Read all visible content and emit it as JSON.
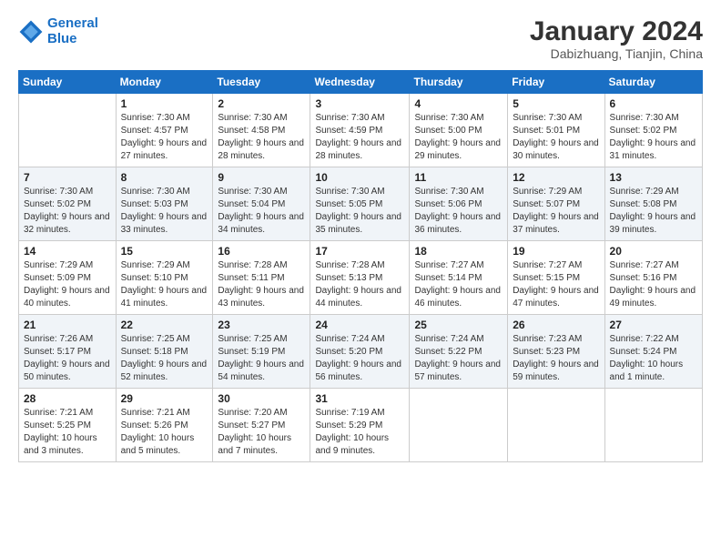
{
  "header": {
    "logo_line1": "General",
    "logo_line2": "Blue",
    "month_title": "January 2024",
    "location": "Dabizhuang, Tianjin, China"
  },
  "days_of_week": [
    "Sunday",
    "Monday",
    "Tuesday",
    "Wednesday",
    "Thursday",
    "Friday",
    "Saturday"
  ],
  "weeks": [
    [
      {
        "num": "",
        "sunrise": "",
        "sunset": "",
        "daylight": ""
      },
      {
        "num": "1",
        "sunrise": "Sunrise: 7:30 AM",
        "sunset": "Sunset: 4:57 PM",
        "daylight": "Daylight: 9 hours and 27 minutes."
      },
      {
        "num": "2",
        "sunrise": "Sunrise: 7:30 AM",
        "sunset": "Sunset: 4:58 PM",
        "daylight": "Daylight: 9 hours and 28 minutes."
      },
      {
        "num": "3",
        "sunrise": "Sunrise: 7:30 AM",
        "sunset": "Sunset: 4:59 PM",
        "daylight": "Daylight: 9 hours and 28 minutes."
      },
      {
        "num": "4",
        "sunrise": "Sunrise: 7:30 AM",
        "sunset": "Sunset: 5:00 PM",
        "daylight": "Daylight: 9 hours and 29 minutes."
      },
      {
        "num": "5",
        "sunrise": "Sunrise: 7:30 AM",
        "sunset": "Sunset: 5:01 PM",
        "daylight": "Daylight: 9 hours and 30 minutes."
      },
      {
        "num": "6",
        "sunrise": "Sunrise: 7:30 AM",
        "sunset": "Sunset: 5:02 PM",
        "daylight": "Daylight: 9 hours and 31 minutes."
      }
    ],
    [
      {
        "num": "7",
        "sunrise": "Sunrise: 7:30 AM",
        "sunset": "Sunset: 5:02 PM",
        "daylight": "Daylight: 9 hours and 32 minutes."
      },
      {
        "num": "8",
        "sunrise": "Sunrise: 7:30 AM",
        "sunset": "Sunset: 5:03 PM",
        "daylight": "Daylight: 9 hours and 33 minutes."
      },
      {
        "num": "9",
        "sunrise": "Sunrise: 7:30 AM",
        "sunset": "Sunset: 5:04 PM",
        "daylight": "Daylight: 9 hours and 34 minutes."
      },
      {
        "num": "10",
        "sunrise": "Sunrise: 7:30 AM",
        "sunset": "Sunset: 5:05 PM",
        "daylight": "Daylight: 9 hours and 35 minutes."
      },
      {
        "num": "11",
        "sunrise": "Sunrise: 7:30 AM",
        "sunset": "Sunset: 5:06 PM",
        "daylight": "Daylight: 9 hours and 36 minutes."
      },
      {
        "num": "12",
        "sunrise": "Sunrise: 7:29 AM",
        "sunset": "Sunset: 5:07 PM",
        "daylight": "Daylight: 9 hours and 37 minutes."
      },
      {
        "num": "13",
        "sunrise": "Sunrise: 7:29 AM",
        "sunset": "Sunset: 5:08 PM",
        "daylight": "Daylight: 9 hours and 39 minutes."
      }
    ],
    [
      {
        "num": "14",
        "sunrise": "Sunrise: 7:29 AM",
        "sunset": "Sunset: 5:09 PM",
        "daylight": "Daylight: 9 hours and 40 minutes."
      },
      {
        "num": "15",
        "sunrise": "Sunrise: 7:29 AM",
        "sunset": "Sunset: 5:10 PM",
        "daylight": "Daylight: 9 hours and 41 minutes."
      },
      {
        "num": "16",
        "sunrise": "Sunrise: 7:28 AM",
        "sunset": "Sunset: 5:11 PM",
        "daylight": "Daylight: 9 hours and 43 minutes."
      },
      {
        "num": "17",
        "sunrise": "Sunrise: 7:28 AM",
        "sunset": "Sunset: 5:13 PM",
        "daylight": "Daylight: 9 hours and 44 minutes."
      },
      {
        "num": "18",
        "sunrise": "Sunrise: 7:27 AM",
        "sunset": "Sunset: 5:14 PM",
        "daylight": "Daylight: 9 hours and 46 minutes."
      },
      {
        "num": "19",
        "sunrise": "Sunrise: 7:27 AM",
        "sunset": "Sunset: 5:15 PM",
        "daylight": "Daylight: 9 hours and 47 minutes."
      },
      {
        "num": "20",
        "sunrise": "Sunrise: 7:27 AM",
        "sunset": "Sunset: 5:16 PM",
        "daylight": "Daylight: 9 hours and 49 minutes."
      }
    ],
    [
      {
        "num": "21",
        "sunrise": "Sunrise: 7:26 AM",
        "sunset": "Sunset: 5:17 PM",
        "daylight": "Daylight: 9 hours and 50 minutes."
      },
      {
        "num": "22",
        "sunrise": "Sunrise: 7:25 AM",
        "sunset": "Sunset: 5:18 PM",
        "daylight": "Daylight: 9 hours and 52 minutes."
      },
      {
        "num": "23",
        "sunrise": "Sunrise: 7:25 AM",
        "sunset": "Sunset: 5:19 PM",
        "daylight": "Daylight: 9 hours and 54 minutes."
      },
      {
        "num": "24",
        "sunrise": "Sunrise: 7:24 AM",
        "sunset": "Sunset: 5:20 PM",
        "daylight": "Daylight: 9 hours and 56 minutes."
      },
      {
        "num": "25",
        "sunrise": "Sunrise: 7:24 AM",
        "sunset": "Sunset: 5:22 PM",
        "daylight": "Daylight: 9 hours and 57 minutes."
      },
      {
        "num": "26",
        "sunrise": "Sunrise: 7:23 AM",
        "sunset": "Sunset: 5:23 PM",
        "daylight": "Daylight: 9 hours and 59 minutes."
      },
      {
        "num": "27",
        "sunrise": "Sunrise: 7:22 AM",
        "sunset": "Sunset: 5:24 PM",
        "daylight": "Daylight: 10 hours and 1 minute."
      }
    ],
    [
      {
        "num": "28",
        "sunrise": "Sunrise: 7:21 AM",
        "sunset": "Sunset: 5:25 PM",
        "daylight": "Daylight: 10 hours and 3 minutes."
      },
      {
        "num": "29",
        "sunrise": "Sunrise: 7:21 AM",
        "sunset": "Sunset: 5:26 PM",
        "daylight": "Daylight: 10 hours and 5 minutes."
      },
      {
        "num": "30",
        "sunrise": "Sunrise: 7:20 AM",
        "sunset": "Sunset: 5:27 PM",
        "daylight": "Daylight: 10 hours and 7 minutes."
      },
      {
        "num": "31",
        "sunrise": "Sunrise: 7:19 AM",
        "sunset": "Sunset: 5:29 PM",
        "daylight": "Daylight: 10 hours and 9 minutes."
      },
      {
        "num": "",
        "sunrise": "",
        "sunset": "",
        "daylight": ""
      },
      {
        "num": "",
        "sunrise": "",
        "sunset": "",
        "daylight": ""
      },
      {
        "num": "",
        "sunrise": "",
        "sunset": "",
        "daylight": ""
      }
    ]
  ]
}
